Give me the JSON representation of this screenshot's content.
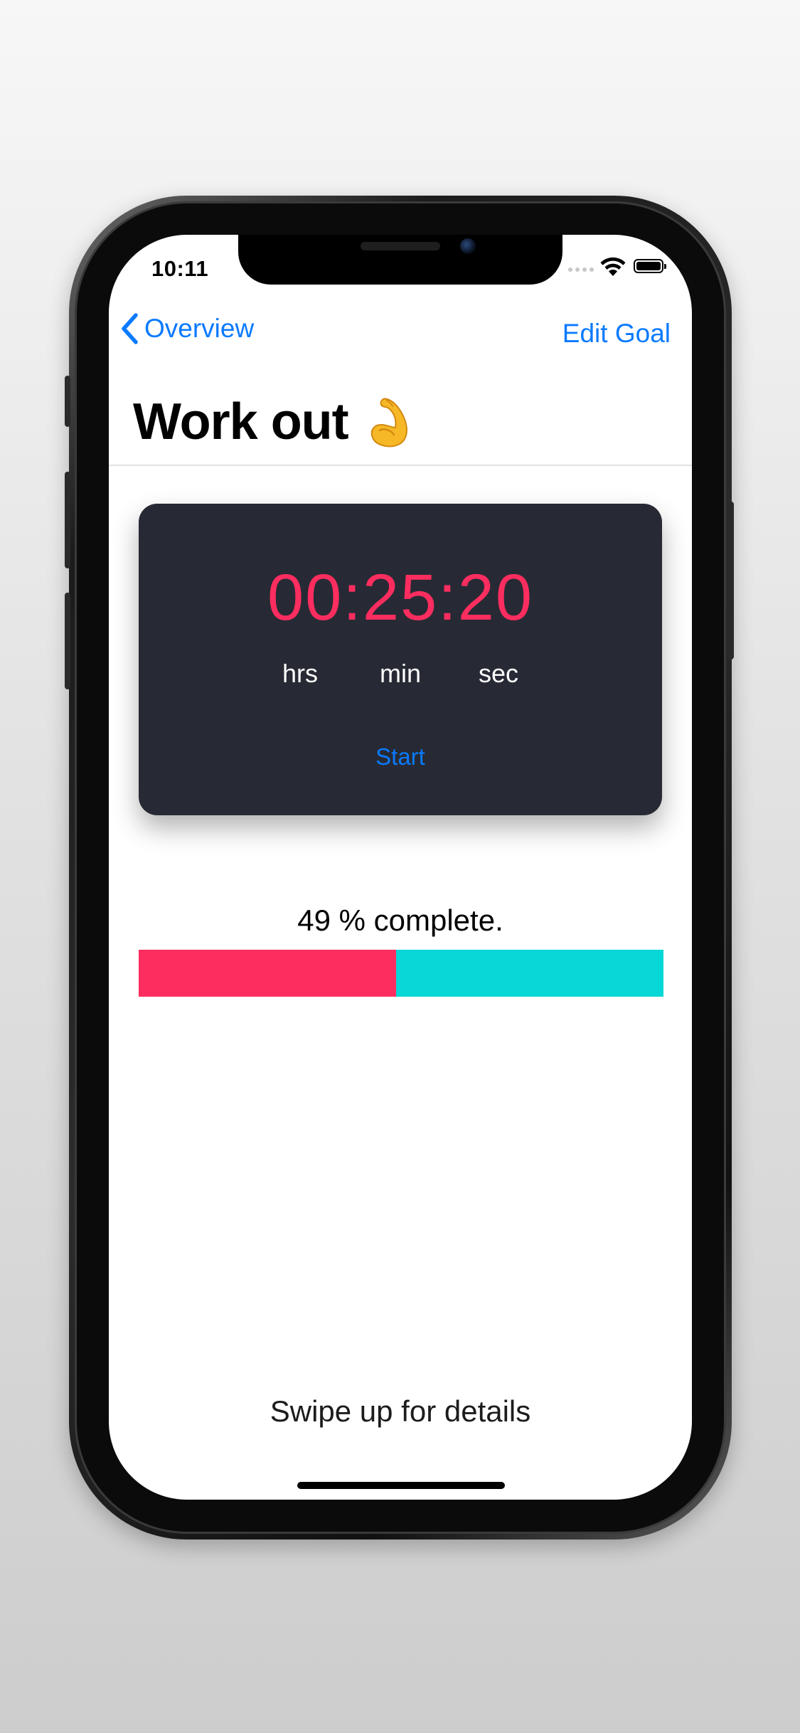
{
  "status_bar": {
    "time": "10:11"
  },
  "nav": {
    "back_label": "Overview",
    "edit_label": "Edit Goal"
  },
  "page": {
    "title": "Work out",
    "title_icon": "flexed-biceps-icon"
  },
  "timer": {
    "display": "00:25:20",
    "units": {
      "hrs": "hrs",
      "min": "min",
      "sec": "sec"
    },
    "start_label": "Start"
  },
  "progress": {
    "label": "49 % complete.",
    "fraction": 0.49,
    "colors": {
      "done": "#fd2d5f",
      "remaining": "#07d7d6"
    }
  },
  "footer": {
    "hint": "Swipe up for details"
  },
  "colors": {
    "accent": "#0a7aff",
    "timer_text": "#fd2d5f",
    "card_bg": "#272a34"
  }
}
